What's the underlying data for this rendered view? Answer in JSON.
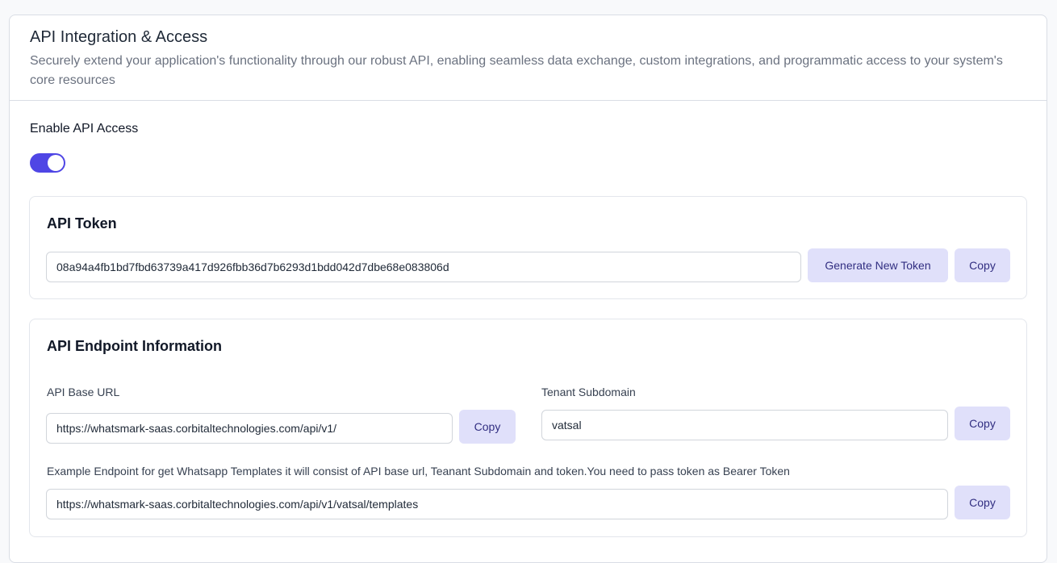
{
  "header": {
    "title": "API Integration & Access",
    "description": "Securely extend your application's functionality through our robust API, enabling seamless data exchange, custom integrations, and programmatic access to your system's core resources"
  },
  "enable_api": {
    "label": "Enable API Access",
    "enabled": true
  },
  "token_section": {
    "title": "API Token",
    "token_value": "08a94a4fb1bd7fbd63739a417d926fbb36d7b6293d1bdd042d7dbe68e083806d",
    "generate_label": "Generate New Token",
    "copy_label": "Copy"
  },
  "endpoint_section": {
    "title": "API Endpoint Information",
    "base_url_label": "API Base URL",
    "base_url_value": "https://whatsmark-saas.corbitaltechnologies.com/api/v1/",
    "base_url_copy": "Copy",
    "subdomain_label": "Tenant Subdomain",
    "subdomain_value": "vatsal",
    "subdomain_copy": "Copy",
    "example_label": "Example Endpoint for get Whatsapp Templates it will consist of API base url, Teanant Subdomain and token.You need to pass token as Bearer Token",
    "example_value": "https://whatsmark-saas.corbitaltechnologies.com/api/v1/vatsal/templates",
    "example_copy": "Copy"
  },
  "colors": {
    "accent": "#4f46e5",
    "button_bg": "#e0e0fa",
    "button_text": "#312e81"
  }
}
